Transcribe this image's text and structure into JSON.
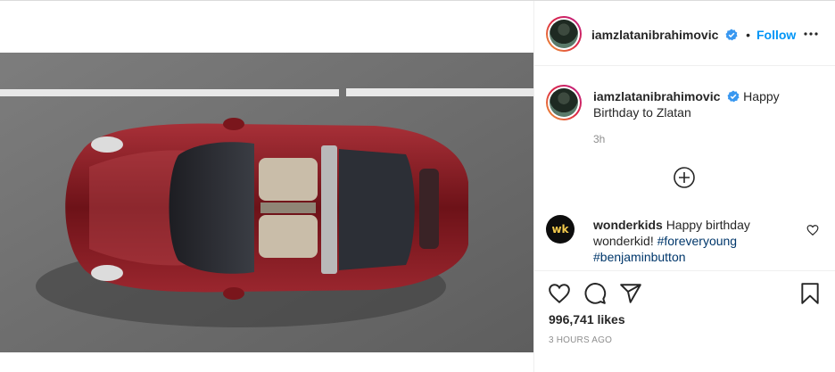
{
  "post": {
    "author": {
      "username": "iamzlatanibrahimovic",
      "verified": true,
      "follow_label": "Follow",
      "separator": "•"
    },
    "caption": {
      "username": "iamzlatanibrahimovic",
      "text": "Happy Birthday to Zlatan",
      "time": "3h"
    },
    "comments": [
      {
        "username": "wonderkids",
        "avatar_text": "wk",
        "text": "Happy birthday wonderkid!",
        "hashtags": [
          "#foreveryoung",
          "#benjaminbutton"
        ]
      }
    ],
    "likes_text": "996,741 likes",
    "timestamp": "3 hours ago",
    "photo_subject": "red-convertible-sports-car-top-view"
  },
  "icons": {
    "more": "more-options-icon",
    "load_more": "plus-circle-icon",
    "like": "heart-icon",
    "comment": "comment-icon",
    "share": "share-icon",
    "save": "bookmark-icon",
    "comment_like": "heart-small-icon",
    "verified": "verified-badge-icon"
  },
  "colors": {
    "link_blue": "#0095f6",
    "hashtag": "#00376b",
    "verified_blue": "#3897f0",
    "text_secondary": "#8e8e8e",
    "car_red": "#8a1c22"
  }
}
